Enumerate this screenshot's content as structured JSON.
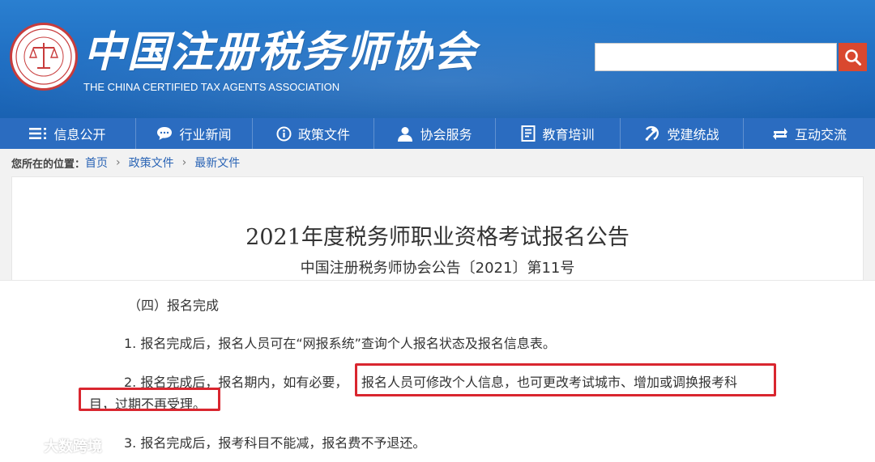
{
  "header": {
    "logo_cn": "中国注册税务师协会",
    "logo_en": "THE CHINA CERTIFIED TAX AGENTS ASSOCIATION",
    "search": {
      "value": "",
      "placeholder": ""
    }
  },
  "nav": {
    "items": [
      {
        "label": "信息公开",
        "icon": "list-icon"
      },
      {
        "label": "行业新闻",
        "icon": "chat-bubble-icon"
      },
      {
        "label": "政策文件",
        "icon": "info-circle-icon"
      },
      {
        "label": "协会服务",
        "icon": "person-icon"
      },
      {
        "label": "教育培训",
        "icon": "book-icon"
      },
      {
        "label": "党建统战",
        "icon": "hammer-sickle-icon"
      },
      {
        "label": "互动交流",
        "icon": "exchange-arrows-icon"
      }
    ]
  },
  "breadcrumb": {
    "label": "您所在的位置：",
    "items": [
      "首页",
      "政策文件",
      "最新文件"
    ],
    "separator": "›"
  },
  "article": {
    "title": "2021年度税务师职业资格考试报名公告",
    "subtitle": "中国注册税务师协会公告〔2021〕第11号",
    "section_heading": "（四）报名完成",
    "para1": "1. 报名完成后，报名人员可在“网报系统”查询个人报名状态及报名信息表。",
    "para2_start": "2. 报名完成后，报名期内，如有必要，",
    "para2_highlight": "报名人员可修改个人信息，也可更改考试城市、增加或调换报考科",
    "para2_cont": "目，过期不再受理。",
    "para3": "3. 报名完成后，报考科目不能减，报名费不予退还。"
  },
  "watermark": {
    "text": "大数跨境"
  },
  "colors": {
    "header_blue": "#1e6cc0",
    "nav_blue": "#2b6cc0",
    "search_red": "#d9482f",
    "highlight_red": "#d9262f",
    "link_blue": "#2a64b5"
  }
}
